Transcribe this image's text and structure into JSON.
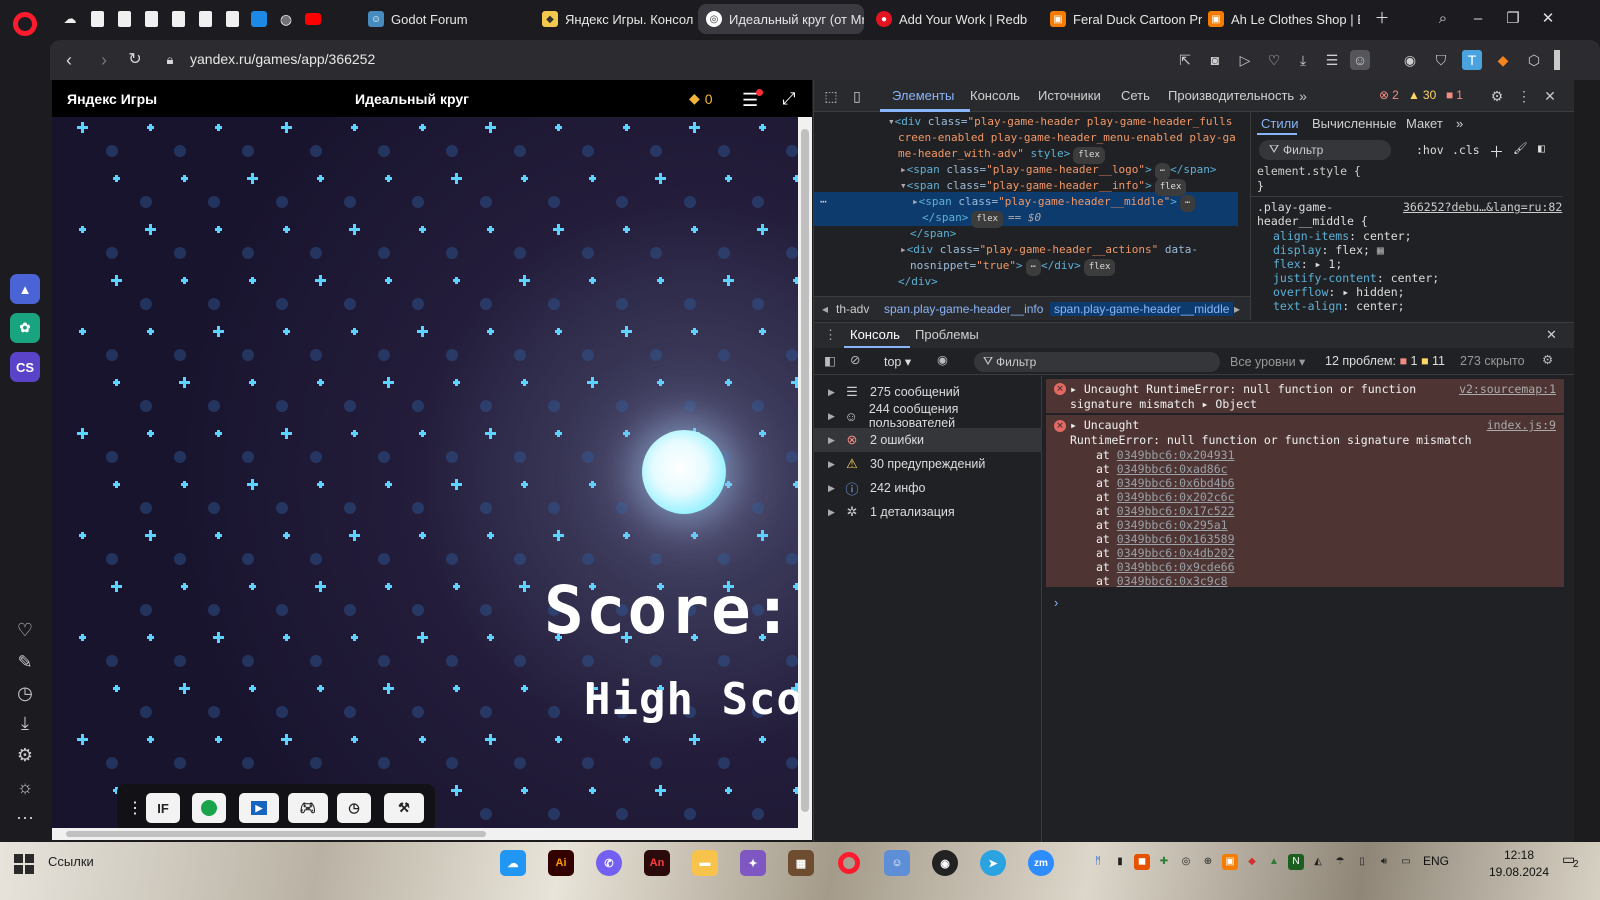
{
  "browser": {
    "tabs": [
      {
        "label": "Godot Forum"
      },
      {
        "label": "Яндекс Игры. Консоль"
      },
      {
        "label": "Идеальный круг (от Mr.D"
      },
      {
        "label": "Add Your Work | Redbub"
      },
      {
        "label": "Feral Duck Cartoon Print"
      },
      {
        "label": "Ah Le Clothes Shop | Buy"
      }
    ],
    "url": "yandex.ru/games/app/366252"
  },
  "game": {
    "header_logo": "Яндекс Игры",
    "header_title": "Идеальный круг",
    "coins": "0",
    "score_label": "Score:",
    "high_score_label": "High Scor",
    "toolbar": {
      "btn1": "IF"
    }
  },
  "devtools": {
    "tabs": {
      "elements": "Элементы",
      "console": "Консоль",
      "sources": "Источники",
      "network": "Сеть",
      "performance": "Производительность"
    },
    "errors_count": "2",
    "warnings_count": "30",
    "info_count": "1",
    "elements": {
      "line1_tag": "<div",
      "line1_attr": " class=",
      "line1_val": "\"play-game-header play-game-header_fulls",
      "line2": "creen-enabled play-game-header_menu-enabled play-ga",
      "line3_val": "me-header_with-adv\"",
      "line3_rest": " style>",
      "flex": "flex",
      "line4_tag": "<span",
      "line4_val": "\"play-game-header__logo\"",
      "line4_close": "</span>",
      "line5_val": "\"play-game-header__info\"",
      "line6_val": "\"play-game-header__middle\"",
      "line7_close": "</span>",
      "dollar0": "== $0",
      "line8": "</span>",
      "line9_tag": "<div",
      "line9_val": "\"play-game-header__actions\"",
      "line9_attr2": " data-",
      "line10_attr": "nosnippet=",
      "line10_val": "\"true\"",
      "line10_close": "</div>",
      "line11": "</div>",
      "class_attr": " class=",
      "crumb1": "th-adv",
      "crumb2": "span.play-game-header__info",
      "crumb3": "span.play-game-header__middle"
    },
    "styles": {
      "tabs": {
        "styles": "Стили",
        "computed": "Вычисленные",
        "layout": "Макет"
      },
      "filter": "Фильтр",
      "hov": ":hov",
      "cls": ".cls",
      "element_style": "element.style {",
      "close_brace": "}",
      "selector1": ".play-game-",
      "selector2": "header__middle {",
      "source": "366252?debu…&lang=ru:82",
      "props": [
        {
          "name": "align-items",
          "value": "center;"
        },
        {
          "name": "display",
          "value": "flex;"
        },
        {
          "name": "flex",
          "value": "1;"
        },
        {
          "name": "justify-content",
          "value": "center;"
        },
        {
          "name": "overflow",
          "value": "hidden;"
        },
        {
          "name": "text-align",
          "value": "center;"
        }
      ]
    },
    "console": {
      "tabs": {
        "console": "Консоль",
        "issues": "Проблемы"
      },
      "context": "top",
      "filter": "Фильтр",
      "levels": "Все уровни",
      "problems": "12 проблем:",
      "problems_err": "1",
      "problems_warn": "11",
      "hidden": "273 скрыто",
      "sidebar": [
        {
          "label": "275 сообщений",
          "icon": "list-icon"
        },
        {
          "label": "244 сообщения пользователей",
          "icon": "user-icon"
        },
        {
          "label": "2 ошибки",
          "icon": "error-icon"
        },
        {
          "label": "30 предупреждений",
          "icon": "warning-icon"
        },
        {
          "label": "242 инфо",
          "icon": "info-icon"
        },
        {
          "label": "1 детализация",
          "icon": "bug-icon"
        }
      ],
      "error1_line1": "Uncaught RuntimeError: null function or function",
      "error1_line2": "signature mismatch",
      "error1_obj": "Object",
      "error1_src": "v2:sourcemap:1",
      "error2_line1": "Uncaught",
      "error2_line2": "RuntimeError: null function or function signature mismatch",
      "error2_src": "index.js:9",
      "at": "at",
      "stack": [
        "0349bbc6:0x204931",
        "0349bbc6:0xad86c",
        "0349bbc6:0x6bd4b6",
        "0349bbc6:0x202c6c",
        "0349bbc6:0x17c522",
        "0349bbc6:0x295a1",
        "0349bbc6:0x163589",
        "0349bbc6:0x4db202",
        "0349bbc6:0x9cde66",
        "0349bbc6:0x3c9c8"
      ]
    }
  },
  "taskbar": {
    "search": "Ссылки",
    "lang": "ENG",
    "time": "12:18",
    "date": "19.08.2024",
    "notif_count": "2"
  },
  "colors": {
    "opera_red": "#ff1b2d",
    "devtools_accent": "#8ab4f8",
    "error_bg": "#4e3534",
    "star_cyan": "#5fd3ff"
  }
}
